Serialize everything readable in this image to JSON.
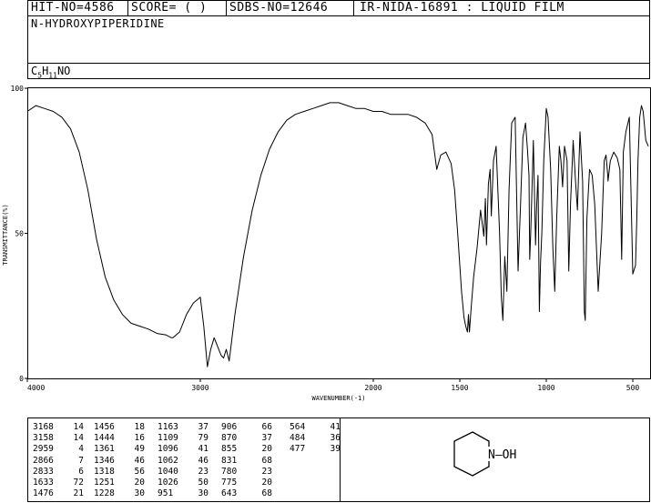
{
  "header": {
    "hit_no": "HIT-NO=4586",
    "score": "SCORE=  (   )",
    "sdbs_no": "SDBS-NO=12646",
    "ir_nida": "IR-NIDA-16891 : LIQUID FILM"
  },
  "compound_name": "N-HYDROXYPIPERIDINE",
  "formula": {
    "c": "C",
    "c_sub": "5",
    "h": "H",
    "h_sub": "11",
    "rest": "NO"
  },
  "chart_data": {
    "type": "line",
    "xlabel": "WAVENUMBER(-1)",
    "ylabel": "TRANSMITTANCE(%)",
    "xlim": [
      4000,
      400
    ],
    "ylim": [
      0,
      100
    ],
    "x_ticks": [
      4000,
      3000,
      2000,
      1500,
      1000,
      500
    ],
    "x_tick_labels": [
      "4000",
      "3000",
      "2000",
      "1500",
      "1000",
      "500"
    ],
    "y_ticks": [
      0,
      50,
      100
    ],
    "y_tick_labels": [
      "0",
      "50",
      "100"
    ],
    "x": [
      4000,
      3950,
      3900,
      3850,
      3800,
      3750,
      3700,
      3650,
      3600,
      3550,
      3500,
      3450,
      3400,
      3350,
      3300,
      3250,
      3200,
      3168,
      3158,
      3120,
      3080,
      3040,
      3000,
      2980,
      2959,
      2940,
      2920,
      2900,
      2880,
      2866,
      2850,
      2833,
      2800,
      2750,
      2700,
      2650,
      2600,
      2550,
      2500,
      2450,
      2400,
      2350,
      2300,
      2250,
      2200,
      2150,
      2100,
      2050,
      2000,
      1950,
      1900,
      1850,
      1800,
      1750,
      1700,
      1660,
      1633,
      1610,
      1580,
      1550,
      1530,
      1510,
      1490,
      1476,
      1466,
      1456,
      1450,
      1444,
      1435,
      1420,
      1400,
      1380,
      1361,
      1352,
      1346,
      1335,
      1325,
      1318,
      1305,
      1290,
      1270,
      1260,
      1251,
      1240,
      1228,
      1215,
      1200,
      1180,
      1163,
      1150,
      1135,
      1120,
      1109,
      1100,
      1096,
      1090,
      1075,
      1062,
      1055,
      1048,
      1040,
      1033,
      1026,
      1015,
      1000,
      990,
      975,
      962,
      951,
      940,
      925,
      915,
      906,
      895,
      880,
      870,
      860,
      845,
      831,
      820,
      805,
      790,
      780,
      775,
      765,
      750,
      735,
      720,
      700,
      680,
      665,
      655,
      645,
      643,
      630,
      610,
      590,
      575,
      564,
      555,
      540,
      520,
      500,
      484,
      477,
      470,
      460,
      450,
      440,
      425,
      410,
      400
    ],
    "y": [
      92,
      94,
      93,
      92,
      90,
      86,
      78,
      65,
      48,
      35,
      27,
      22,
      19,
      18,
      17,
      15.5,
      15,
      14,
      14,
      16,
      22,
      26,
      28,
      18,
      4,
      10,
      14,
      11,
      8,
      7,
      10,
      6,
      22,
      42,
      58,
      70,
      79,
      85,
      89,
      91,
      92,
      93,
      94,
      95,
      95,
      94,
      93,
      93,
      92,
      92,
      91,
      91,
      91,
      90,
      88,
      84,
      72,
      77,
      78,
      74,
      65,
      48,
      30,
      21,
      18,
      16,
      22,
      16,
      24,
      35,
      45,
      58,
      49,
      62,
      46,
      67,
      72,
      56,
      75,
      80,
      50,
      28,
      20,
      42,
      30,
      65,
      88,
      90,
      37,
      58,
      83,
      88,
      79,
      70,
      41,
      50,
      82,
      46,
      60,
      70,
      23,
      40,
      50,
      75,
      93,
      90,
      72,
      45,
      30,
      55,
      80,
      75,
      66,
      80,
      75,
      37,
      60,
      82,
      68,
      58,
      85,
      68,
      23,
      20,
      55,
      72,
      70,
      60,
      30,
      50,
      75,
      77,
      70,
      68,
      75,
      78,
      76,
      72,
      41,
      78,
      85,
      90,
      36,
      39,
      55,
      75,
      90,
      94,
      92,
      82,
      80
    ]
  },
  "peak_table": [
    [
      [
        "3168",
        "14"
      ],
      [
        "3158",
        "14"
      ],
      [
        "2959",
        "4"
      ],
      [
        "2866",
        "7"
      ],
      [
        "2833",
        "6"
      ],
      [
        "1633",
        "72"
      ],
      [
        "1476",
        "21"
      ]
    ],
    [
      [
        "1456",
        "18"
      ],
      [
        "1444",
        "16"
      ],
      [
        "1361",
        "49"
      ],
      [
        "1346",
        "46"
      ],
      [
        "1318",
        "56"
      ],
      [
        "1251",
        "20"
      ],
      [
        "1228",
        "30"
      ]
    ],
    [
      [
        "1163",
        "37"
      ],
      [
        "1109",
        "79"
      ],
      [
        "1096",
        "41"
      ],
      [
        "1062",
        "46"
      ],
      [
        "1040",
        "23"
      ],
      [
        "1026",
        "50"
      ],
      [
        "951",
        "30"
      ]
    ],
    [
      [
        "906",
        "66"
      ],
      [
        "870",
        "37"
      ],
      [
        "855",
        "20"
      ],
      [
        "831",
        "68"
      ],
      [
        "780",
        "23"
      ],
      [
        "775",
        "20"
      ],
      [
        "643",
        "68"
      ]
    ],
    [
      [
        "564",
        "41"
      ],
      [
        "484",
        "36"
      ],
      [
        "477",
        "39"
      ]
    ]
  ],
  "structure": {
    "group_label": "N—OH"
  }
}
